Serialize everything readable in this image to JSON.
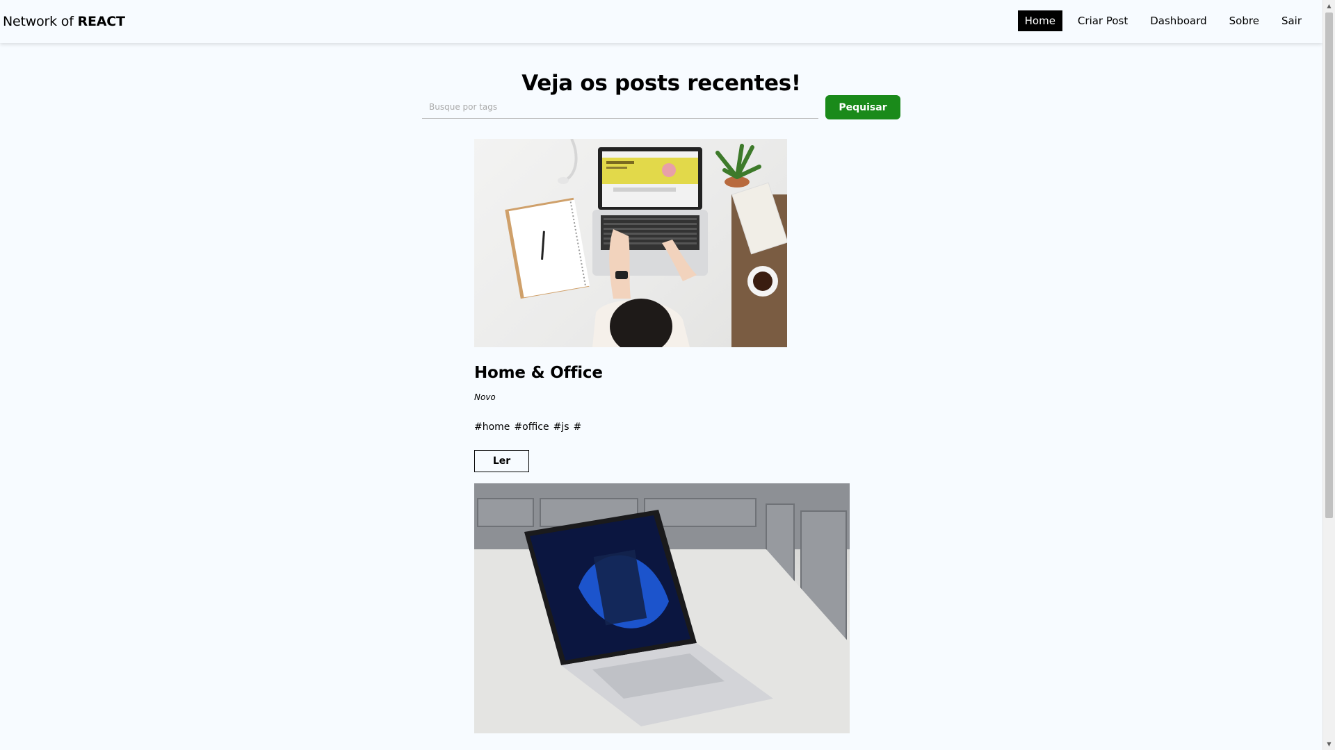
{
  "navbar": {
    "brand_prefix": "Network of ",
    "brand_strong": "REACT",
    "links": [
      {
        "label": "Home",
        "active": true
      },
      {
        "label": "Criar Post",
        "active": false
      },
      {
        "label": "Dashboard",
        "active": false
      },
      {
        "label": "Sobre",
        "active": false
      },
      {
        "label": "Sair",
        "active": false
      }
    ]
  },
  "home": {
    "title": "Veja os posts recentes!",
    "search_placeholder": "Busque por tags",
    "search_button": "Pequisar"
  },
  "posts": [
    {
      "title": "Home & Office",
      "author": "Novo",
      "tags": [
        "#home",
        "#office",
        "#js",
        "#"
      ],
      "read_label": "Ler"
    },
    {
      "title": "",
      "author": "",
      "tags": [],
      "read_label": ""
    }
  ],
  "colors": {
    "background": "#f7fbff",
    "search_button": "#1a8a1a",
    "active_nav_bg": "#000000",
    "active_nav_text": "#ffffff"
  }
}
